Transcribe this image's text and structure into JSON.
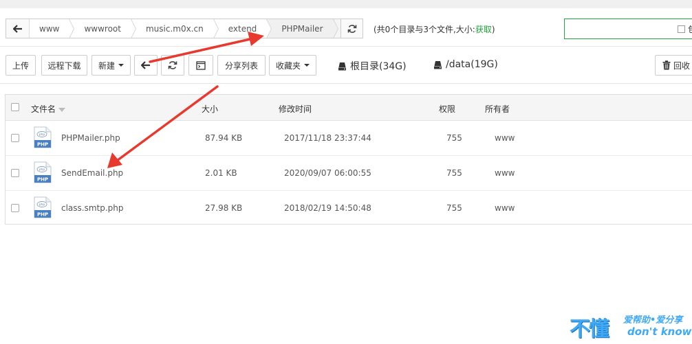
{
  "breadcrumb": {
    "items": [
      "www",
      "wwwroot",
      "music.m0x.cn",
      "extend",
      "PHPMailer"
    ]
  },
  "summary": {
    "text": "(共0个目录与3个文件,大小:",
    "link": "获取",
    "suffix": ")"
  },
  "search": {
    "checkbox_label": "包"
  },
  "toolbar": {
    "upload": "上传",
    "remote_download": "远程下载",
    "new": "新建",
    "share_list": "分享列表",
    "favorites": "收藏夹",
    "disk_root": "根目录(34G)",
    "disk_data": "/data(19G)",
    "recycle": "回收"
  },
  "table": {
    "headers": {
      "name": "文件名",
      "size": "大小",
      "modified": "修改时间",
      "perm": "权限",
      "owner": "所有者"
    },
    "rows": [
      {
        "name": "PHPMailer.php",
        "size": "87.94 KB",
        "modified": "2017/11/18 23:37:44",
        "perm": "755",
        "owner": "www"
      },
      {
        "name": "SendEmail.php",
        "size": "2.01 KB",
        "modified": "2020/09/07 06:00:55",
        "perm": "755",
        "owner": "www"
      },
      {
        "name": "class.smtp.php",
        "size": "27.98 KB",
        "modified": "2018/02/19 14:50:48",
        "perm": "755",
        "owner": "www"
      }
    ],
    "file_icon_label": "PHP",
    "file_icon_small": "php"
  },
  "watermark": {
    "big": "不懂",
    "top": "爱帮助•爱分享",
    "bottom": "don't know"
  },
  "colors": {
    "accent_green": "#20a53a",
    "arrow_red": "#e8392e",
    "file_icon_blue": "#4a7fc1"
  }
}
